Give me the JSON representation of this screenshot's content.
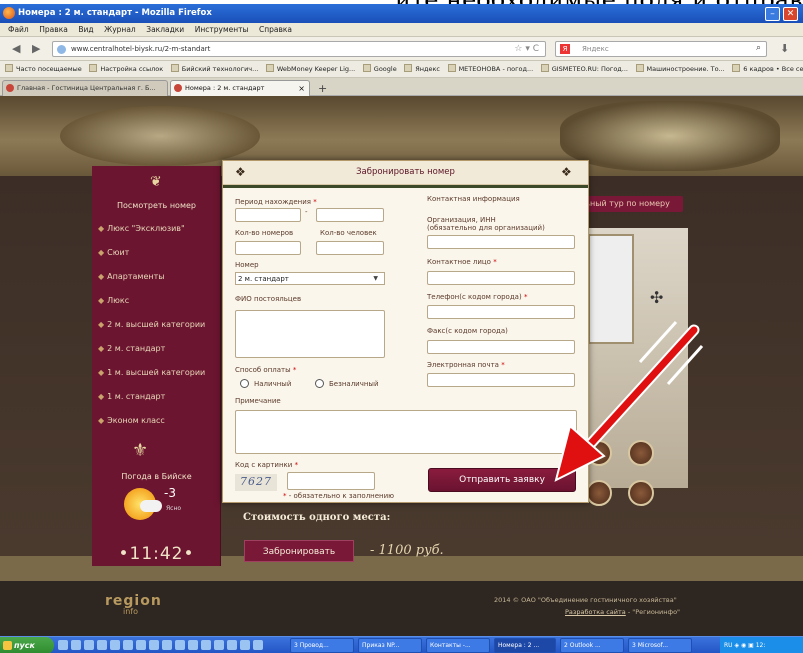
{
  "overlay_caption": "ите необходимые поля и отправляете заявку",
  "browser": {
    "window_title": "Номера : 2 м. стандарт - Mozilla Firefox",
    "menu": [
      "Файл",
      "Правка",
      "Вид",
      "Журнал",
      "Закладки",
      "Инструменты",
      "Справка"
    ],
    "url": "www.centralhotel-biysk.ru/2-m-standart",
    "search_placeholder": "Яндекс",
    "bookmarks": [
      "Часто посещаемые",
      "Настройка ссылок",
      "Бийский технологич...",
      "WebMoney Keeper Lig...",
      "Google",
      "Яндекс",
      "МЕТЕОНОВА - погод...",
      "GISMETEO.RU: Погод...",
      "Машиностроение. То...",
      "6 кадров • Все серии..."
    ],
    "tabs": [
      {
        "label": "Главная - Гостиница Центральная г. Б...",
        "active": false
      },
      {
        "label": "Номера : 2 м. стандарт",
        "active": true
      }
    ]
  },
  "sidebar": {
    "heading": "Посмотреть номер",
    "items": [
      "Люкс \"Эксклюзив\"",
      "Сюит",
      "Апартаменты",
      "Люкс",
      "2 м. высшей категории",
      "2 м. стандарт",
      "1 м. высшей категории",
      "1 м. стандарт",
      "Эконом класс"
    ],
    "weather_title": "Погода в Бийске",
    "temperature": "-3",
    "condition": "Ясно",
    "clock": "11:42"
  },
  "page": {
    "virtual_tour_button": "Виртуальный тур по номеру",
    "price_caption": "Стоимость одного места:",
    "book_button": "Забронировать",
    "price": "- 1100 руб.",
    "footer_logo": "region",
    "footer_logo_sub": "info",
    "copyright": "2014 © ОАО \"Объединение гостиничного хозяйства\"",
    "developer_prefix": "Разработка сайта",
    "developer_name": "\"Регионинфо\""
  },
  "modal": {
    "title": "Забронировать номер",
    "labels": {
      "stay_period": "Период нахождения",
      "rooms_count": "Кол-во номеров",
      "persons_count": "Кол-во человек",
      "room": "Номер",
      "guest_names": "ФИО постояльцев",
      "payment_method": "Способ оплаты",
      "cash": "Наличный",
      "cashless": "Безналичный",
      "note": "Примечание",
      "captcha_code": "Код с картинки",
      "required_note": "- обязательно к заполнению",
      "contact_info": "Контактная информация",
      "organization": "Организация, ИНН",
      "organization_hint": "(обязательно для организаций)",
      "contact_person": "Контактное лицо",
      "phone": "Телефон(с кодом города)",
      "fax": "Факс(с кодом города)",
      "email": "Электронная почта"
    },
    "required_mark": "*",
    "period_separator": "-",
    "room_selected": "2 м. стандарт",
    "captcha_text": "7627",
    "submit_label": "Отправить заявку"
  },
  "taskbar": {
    "start": "пуск",
    "buttons": [
      "3 Провод...",
      "Приказ NP...",
      "Контакты -...",
      "Номера : 2 ...",
      "2 Outlook ...",
      "3 Microsof..."
    ],
    "tray_lang": "RU",
    "tray_time": "12:"
  },
  "colors": {
    "brand_maroon": "#6b1530",
    "submit_button": "#7a1838",
    "annotation_arrow": "#e01010"
  }
}
